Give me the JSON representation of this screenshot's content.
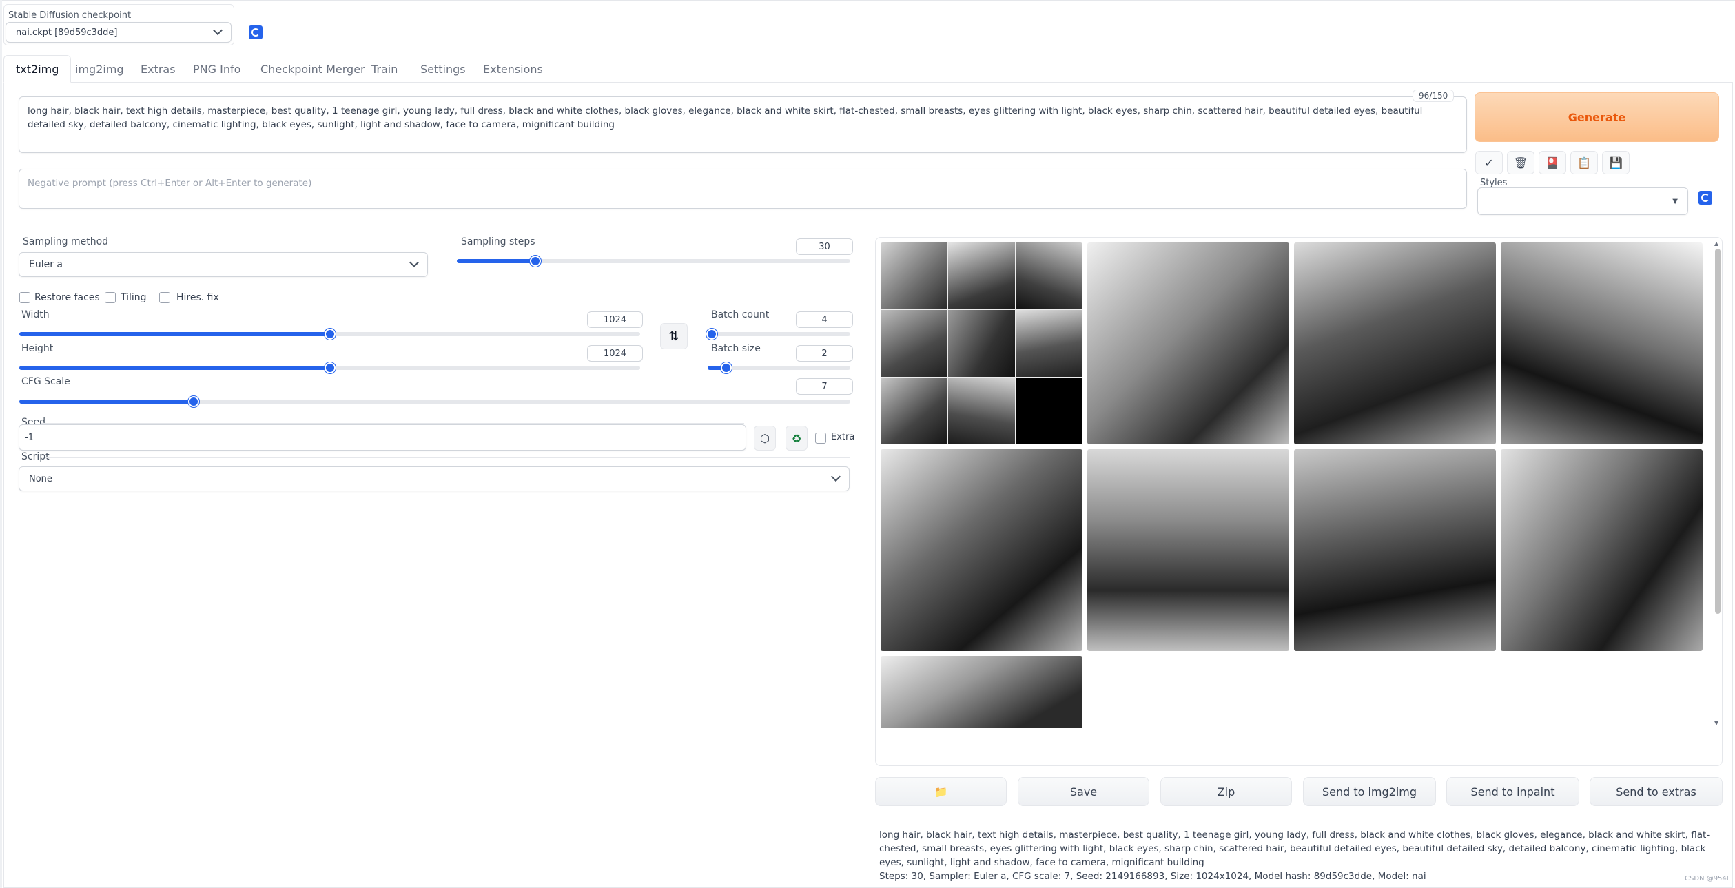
{
  "checkpoint": {
    "label": "Stable Diffusion checkpoint",
    "value": "nai.ckpt [89d59c3dde]"
  },
  "tabs": [
    {
      "label": "txt2img",
      "active": true
    },
    {
      "label": "img2img"
    },
    {
      "label": "Extras"
    },
    {
      "label": "PNG Info"
    },
    {
      "label": "Checkpoint Merger"
    },
    {
      "label": "Train"
    },
    {
      "label": "Settings"
    },
    {
      "label": "Extensions"
    }
  ],
  "prompt": {
    "text": "long hair, black hair, text high details, masterpiece, best quality, 1 teenage girl, young lady, full dress, black and white clothes, black gloves, elegance, black and white skirt, flat-chested, small breasts, eyes glittering with light, black eyes, sharp chin, scattered hair, beautiful detailed eyes, beautiful detailed sky, detailed balcony, cinematic lighting, black eyes, sunlight, light and shadow, face to camera, mignificant building",
    "counter": "96/150"
  },
  "negative_prompt": {
    "placeholder": "Negative prompt (press Ctrl+Enter or Alt+Enter to generate)"
  },
  "generate_label": "Generate",
  "styles_label": "Styles",
  "tool_icons": [
    "✓",
    "🗑",
    "🎴",
    "📋",
    "💾"
  ],
  "sampling": {
    "method_label": "Sampling method",
    "method_value": "Euler a",
    "steps_label": "Sampling steps",
    "steps_value": "30",
    "steps_fraction": 0.2
  },
  "options": {
    "restore_faces": "Restore faces",
    "tiling": "Tiling",
    "hires_fix": "Hires. fix"
  },
  "width": {
    "label": "Width",
    "value": "1024",
    "fraction": 0.5
  },
  "height": {
    "label": "Height",
    "value": "1024",
    "fraction": 0.5
  },
  "batch_count": {
    "label": "Batch count",
    "value": "4",
    "fraction": 0.03
  },
  "batch_size": {
    "label": "Batch size",
    "value": "2",
    "fraction": 0.13
  },
  "cfg": {
    "label": "CFG Scale",
    "value": "7",
    "fraction": 0.21
  },
  "seed": {
    "label": "Seed",
    "value": "-1",
    "extra_label": "Extra"
  },
  "script": {
    "label": "Script",
    "value": "None"
  },
  "gallery_buttons": {
    "folder": "📁",
    "save": "Save",
    "zip": "Zip",
    "send_img2img": "Send to img2img",
    "send_inpaint": "Send to inpaint",
    "send_extras": "Send to extras"
  },
  "info": {
    "prompt": "long hair, black hair, text high details, masterpiece, best quality, 1 teenage girl, young lady, full dress, black and white clothes, black gloves, elegance, black and white skirt, flat-chested, small breasts, eyes glittering with light, black eyes, sharp chin, scattered hair, beautiful detailed eyes, beautiful detailed sky, detailed balcony, cinematic lighting, black eyes, sunlight, light and shadow, face to camera, mignificant building",
    "params": "Steps: 30, Sampler: Euler a, CFG scale: 7, Seed: 2149166893, Size: 1024x1024, Model hash: 89d59c3dde, Model: nai"
  },
  "watermark": "CSDN @954L",
  "colors": {
    "accent": "#2563eb",
    "generate_bg": "#fcc89a",
    "generate_text": "#ea580c"
  }
}
